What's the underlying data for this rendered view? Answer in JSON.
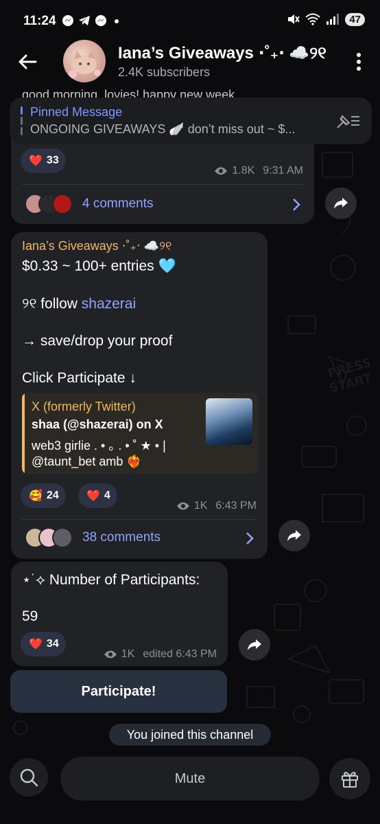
{
  "status_bar": {
    "time": "11:24",
    "battery": "47",
    "left_icons": [
      "messenger-icon",
      "telegram-icon",
      "messenger-icon",
      "dot-icon"
    ],
    "right_icons": [
      "mute-icon",
      "wifi-icon",
      "signal-icon"
    ]
  },
  "header": {
    "title": "Iana’s Giveaways ⋅˚₊‧ ☁️୨୧",
    "subtitle": "2.4K subscribers"
  },
  "peek_text": "good morning, lovies! happy new week",
  "pinned": {
    "title": "Pinned Message",
    "preview": "ONGOING GIVEAWAYS 🪽 don’t miss out ~ $..."
  },
  "message1": {
    "reactions": [
      {
        "emoji": "❤️",
        "count": "33"
      }
    ],
    "views": "1.8K",
    "time": "9:31 AM",
    "comments": "4 comments"
  },
  "message2": {
    "sender": "Iana’s Giveaways ⋅˚₊‧ ☁️୨୧",
    "line1": "$0.33 ~ 100+ entries 🩵",
    "line2_prefix": "୨୧ follow ",
    "line2_link": "shazerai",
    "line3": "→ save/drop your proof",
    "line4": "Click Participate ↓",
    "preview": {
      "site": "X (formerly Twitter)",
      "title": "shaa (@shazerai) on X",
      "desc_line1": "web3 girlie . • ｡ . • ˚ ★ • |",
      "desc_line2": "@taunt_bet amb ❤️‍🔥"
    },
    "reactions": [
      {
        "emoji": "🥰",
        "count": "24"
      },
      {
        "emoji": "❤️",
        "count": "4"
      }
    ],
    "views": "1K",
    "time": "6:43 PM",
    "comments": "38 comments"
  },
  "message3": {
    "line1": "⋆˙⟡ Number of Participants:",
    "line2": "59",
    "reactions": [
      {
        "emoji": "❤️",
        "count": "34"
      }
    ],
    "views": "1K",
    "time": "edited 6:43 PM"
  },
  "participate_button": "Participate!",
  "service_message": "You joined this channel",
  "bottom_bar": {
    "mute_label": "Mute"
  },
  "colors": {
    "accent_blue": "#8fa5ff",
    "sender_orange": "#f0b860",
    "bubble": "#212226",
    "background": "#0b0b0d"
  }
}
